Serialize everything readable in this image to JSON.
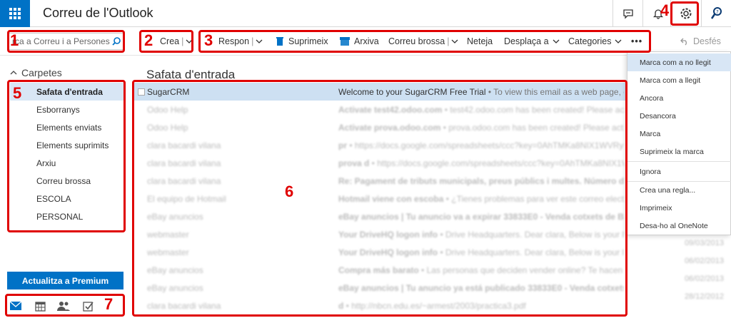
{
  "app": {
    "title": "Correu de l'Outlook"
  },
  "search": {
    "placeholder": "rca a Correu i a Persones"
  },
  "toolbar": {
    "new_label": "Crea",
    "reply_label": "Respon",
    "delete_label": "Suprimeix",
    "archive_label": "Arxiva",
    "junk_label": "Correu brossa",
    "sweep_label": "Neteja",
    "move_label": "Desplaça a",
    "categories_label": "Categories",
    "more_label": "•••",
    "undo_label": "Desfés"
  },
  "folders": {
    "header": "Carpetes",
    "items": [
      {
        "label": "Safata d'entrada",
        "selected": true
      },
      {
        "label": "Esborranys"
      },
      {
        "label": "Elements enviats"
      },
      {
        "label": "Elements suprimits"
      },
      {
        "label": "Arxiu"
      },
      {
        "label": "Correu brossa"
      },
      {
        "label": "ESCOLA"
      },
      {
        "label": "PERSONAL"
      }
    ]
  },
  "list": {
    "title": "Safata d'entrada",
    "rows": [
      {
        "sender": "SugarCRM",
        "subject": "Welcome to your SugarCRM Free Trial",
        "preview": " • To view this email as a web page, clic",
        "selected": true
      },
      {
        "sender": "Odoo Help",
        "subject": "Activate test42.odoo.com",
        "preview": " • test42.odoo.com has been created! Please activate",
        "blurred": true
      },
      {
        "sender": "Odoo Help",
        "subject": "Activate prova.odoo.com",
        "preview": " • prova.odoo.com has been created! Please activate",
        "blurred": true
      },
      {
        "sender": "clara bacardi vilana",
        "subject": "pr",
        "preview": " • https://docs.google.com/spreadsheets/ccc?key=0AhTMKa8NIX1WVRySjhSR",
        "blurred": true
      },
      {
        "sender": "clara bacardi vilana",
        "subject": "prova d",
        "preview": " • https://docs.google.com/spreadsheets/ccc?key=0AhTMKa8NIX1WVRy",
        "blurred": true
      },
      {
        "sender": "clara bacardi vilana",
        "subject": "Re: Pagament de tributs municipals, preus públics i multes. Número de sol·licit",
        "preview": "",
        "blurred": true
      },
      {
        "sender": "El equipo de Hotmail",
        "subject": "Hotmail viene con escoba",
        "preview": " • ¿Tienes problemas para ver este correo electrónico?",
        "blurred": true
      },
      {
        "sender": "eBay anuncios",
        "subject": "eBay anuncios | Tu anuncio va a expirar 33833E0 - Venda cotxets de Bbcost",
        "preview": "",
        "blurred": true
      },
      {
        "sender": "webmaster",
        "subject": "Your DriveHQ logon info",
        "preview": " • Drive Headquarters. Dear clara, Below is your logon info",
        "blurred": true
      },
      {
        "sender": "webmaster",
        "subject": "Your DriveHQ logon info",
        "preview": " • Drive Headquarters. Dear clara, Below is your logon info",
        "blurred": true
      },
      {
        "sender": "eBay anuncios",
        "subject": "Compra más barato",
        "preview": " • Las personas que deciden vender online? Te hacen ahorrar",
        "blurred": true
      },
      {
        "sender": "eBay anuncios",
        "subject": "eBay anuncios | Tu anuncio ya está publicado 33833E0 - Venda cotxets de Bbcost",
        "preview": "",
        "blurred": true
      },
      {
        "sender": "clara bacardi vilana",
        "subject": "d",
        "preview": " • http://nbcn.edu.es/~armest/2003/practica3.pdf",
        "blurred": true
      }
    ]
  },
  "menu": {
    "items": [
      {
        "label": "Marca com a no llegit",
        "highlighted": true
      },
      {
        "label": "Marca com a llegit"
      },
      {
        "label": "Ancora"
      },
      {
        "label": "Desancora"
      },
      {
        "label": "Marca"
      },
      {
        "label": "Suprimeix la marca"
      },
      {
        "label": "Ignora"
      },
      {
        "label": "Crea una regla..."
      },
      {
        "label": "Imprimeix"
      },
      {
        "label": "Desa-ho al OneNote"
      }
    ]
  },
  "premium": {
    "label": "Actualitza a Premium"
  },
  "annotations": [
    "1",
    "2",
    "3",
    "4",
    "5",
    "6",
    "7"
  ],
  "colors": {
    "accent": "#0072c6",
    "annotation": "#e00000",
    "selection": "#cde0f2"
  }
}
